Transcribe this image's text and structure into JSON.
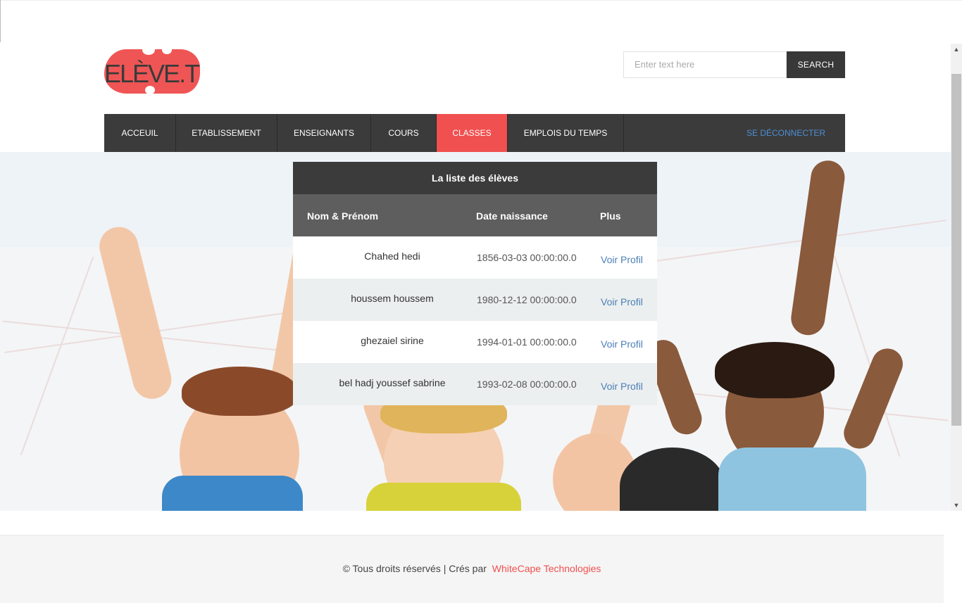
{
  "logo": {
    "text": "ELÈVE.TN"
  },
  "search": {
    "placeholder": "Enter text here",
    "button_label": "SEARCH"
  },
  "nav": {
    "items": [
      {
        "label": "ACCEUIL"
      },
      {
        "label": "ETABLISSEMENT"
      },
      {
        "label": "ENSEIGNANTS"
      },
      {
        "label": "COURS"
      },
      {
        "label": "CLASSES"
      },
      {
        "label": "EMPLOIS DU TEMPS"
      }
    ],
    "active": "CLASSES",
    "logout_label": "SE DÉCONNECTER"
  },
  "table": {
    "title": "La liste des élèves",
    "headers": [
      "Nom & Prénom",
      "Date naissance",
      "Plus"
    ],
    "rows": [
      {
        "name": "Chahed hedi",
        "date": "1856-03-03 00:00:00.0",
        "link": "Voir Profil"
      },
      {
        "name": "houssem houssem",
        "date": "1980-12-12 00:00:00.0",
        "link": "Voir Profil"
      },
      {
        "name": "ghezaiel sirine",
        "date": "1994-01-01 00:00:00.0",
        "link": "Voir Profil"
      },
      {
        "name": "bel hadj youssef sabrine",
        "date": "1993-02-08 00:00:00.0",
        "link": "Voir Profil"
      }
    ]
  },
  "footer": {
    "text": "© Tous droits réservés | Crés par",
    "brand": "WhiteCape Technologies"
  },
  "colors": {
    "accent": "#f0504f",
    "nav_bg": "#3b3b3b",
    "link": "#4c7fb8",
    "logout": "#4c8fd6"
  }
}
